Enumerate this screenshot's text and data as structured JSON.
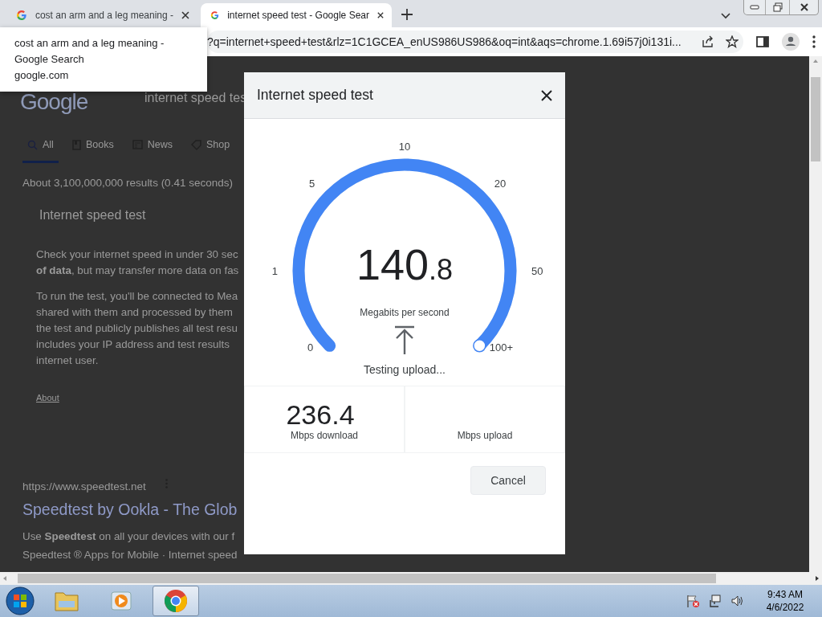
{
  "browser": {
    "tabs": [
      {
        "title": "cost an arm and a leg meaning -",
        "selected": false
      },
      {
        "title": "internet speed test - Google Sear",
        "selected": true
      }
    ],
    "tooltip": {
      "title": "cost an arm and a leg meaning - Google Search",
      "domain": "google.com"
    },
    "address_bar": {
      "url": "?q=internet+speed+test&rlz=1C1GCEA_enUS986US986&oq=int&aqs=chrome.1.69i57j0i131i..."
    }
  },
  "page": {
    "logo": "Google",
    "search_query": "internet speed tes",
    "nav_tabs": [
      {
        "label": "All",
        "kind": "search",
        "selected": true
      },
      {
        "label": "Books",
        "kind": "book",
        "selected": false
      },
      {
        "label": "News",
        "kind": "news",
        "selected": false
      },
      {
        "label": "Shop",
        "kind": "tag",
        "selected": false
      }
    ],
    "result_stats": "About 3,100,000,000 results (0.41 seconds)",
    "card": {
      "title": "Internet speed test",
      "paragraphs": [
        [
          "Check your internet speed in under 30 sec",
          "**of data**, but may transfer more data on fas"
        ],
        [
          "To run the test, you'll be connected to Mea",
          "shared with them and processed by them",
          "the test and publicly publishes all test resu",
          "includes your IP address and test results",
          "internet user."
        ]
      ],
      "link": "About"
    },
    "result": {
      "url": "https://www.speedtest.net",
      "title": "Speedtest by Ookla - The Glob",
      "snippet": [
        "Use **Speedtest** on all your devices with our f",
        "Speedtest ® Apps for Mobile · Internet speed"
      ]
    }
  },
  "dialog": {
    "title": "Internet speed test",
    "gauge": {
      "scale": [
        "0",
        "1",
        "5",
        "10",
        "20",
        "50",
        "100+"
      ],
      "level": 1,
      "value": "140",
      "value_decimal": ".8",
      "unit": "Megabits per second",
      "status": "Testing upload..."
    },
    "results": [
      {
        "value": "236.4",
        "label": "Mbps download"
      },
      {
        "label": "Mbps upload"
      }
    ],
    "cancel": "Cancel"
  },
  "taskbar": {
    "apps": [
      {
        "kind": "folder",
        "selected": false
      },
      {
        "kind": "media",
        "selected": false
      },
      {
        "kind": "chrome",
        "selected": true
      }
    ],
    "time": "9:43 AM",
    "date": "4/6/2022"
  }
}
